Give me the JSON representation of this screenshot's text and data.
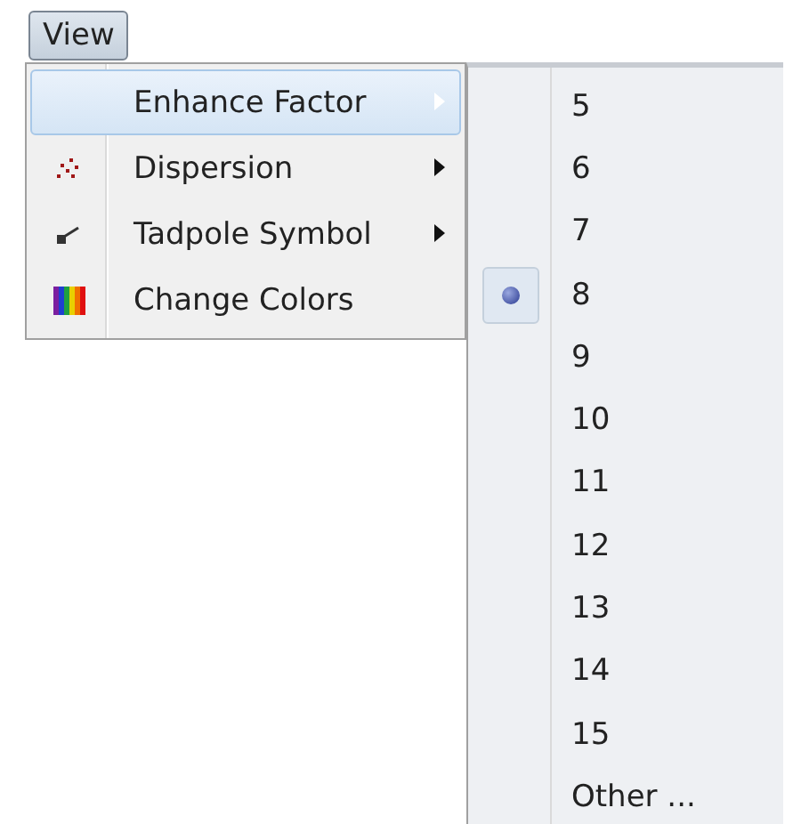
{
  "menu_bar": {
    "label": "View"
  },
  "menu": {
    "items": [
      {
        "label": "Enhance Factor",
        "kind": "plain",
        "selected": true,
        "submenu": true
      },
      {
        "label": "Dispersion",
        "kind": "dots",
        "selected": false,
        "submenu": true
      },
      {
        "label": "Tadpole Symbol",
        "kind": "tadpole",
        "selected": false,
        "submenu": true
      },
      {
        "label": "Change Colors",
        "kind": "colors",
        "selected": false,
        "submenu": false
      }
    ]
  },
  "submenu": {
    "items": [
      {
        "label": "5",
        "selected": false
      },
      {
        "label": "6",
        "selected": false
      },
      {
        "label": "7",
        "selected": false
      },
      {
        "label": "8",
        "selected": true
      },
      {
        "label": "9",
        "selected": false
      },
      {
        "label": "10",
        "selected": false
      },
      {
        "label": "11",
        "selected": false
      },
      {
        "label": "12",
        "selected": false
      },
      {
        "label": "13",
        "selected": false
      },
      {
        "label": "14",
        "selected": false
      },
      {
        "label": "15",
        "selected": false
      },
      {
        "label": "Other ...",
        "selected": false
      }
    ]
  }
}
